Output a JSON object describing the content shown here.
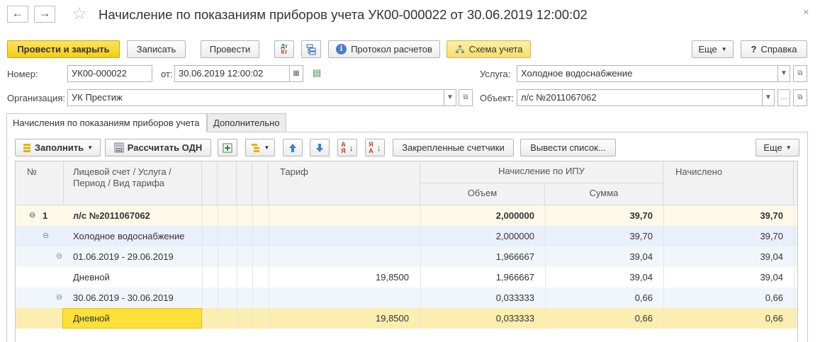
{
  "window": {
    "title": "Начисление по показаниям приборов учета УК00-000022 от 30.06.2019 12:00:02",
    "back_glyph": "←",
    "forward_glyph": "→",
    "close_glyph": "×"
  },
  "command_bar": {
    "post_and_close": "Провести и закрыть",
    "save": "Записать",
    "post": "Провести",
    "calc_protocol": "Протокол расчетов",
    "accounting_scheme": "Схема учета",
    "more": "Еще",
    "help": "Справка",
    "dt_kt_icon": "Дт/Кт"
  },
  "header": {
    "number_label": "Номер:",
    "number_value": "УК00-000022",
    "date_label": "от:",
    "date_value": "30.06.2019 12:00:02",
    "service_label": "Услуга:",
    "service_value": "Холодное водоснабжение",
    "org_label": "Организация:",
    "org_value": "УК Престиж",
    "object_label": "Объект:",
    "object_value": "л/с №2011067062"
  },
  "tabs": [
    {
      "label": "Начисления по показаниям приборов учета",
      "active": true
    },
    {
      "label": "Дополнительно",
      "active": false
    }
  ],
  "table_toolbar": {
    "fill": "Заполнить",
    "calc_odn": "Рассчитать ОДН",
    "fixed_meters": "Закрепленные счетчики",
    "output_list": "Вывести список...",
    "more": "Еще"
  },
  "table": {
    "headers": {
      "num": "№",
      "account_line1": "Лицевой счет / Услуга /",
      "account_line2": "Период / Вид тарифа",
      "tariff": "Тариф",
      "ipu_group": "Начисление по ИПУ",
      "volume": "Объем",
      "sum": "Сумма",
      "accrued": "Начислено"
    },
    "rows": [
      {
        "num": "1",
        "tree": "⊖",
        "name": "л/с №2011067062",
        "tariff": "",
        "volume": "2,000000",
        "sum": "39,70",
        "accrued": "39,70"
      },
      {
        "num": "",
        "tree": "⊖",
        "name": "Холодное водоснабжение",
        "tariff": "",
        "volume": "2,000000",
        "sum": "39,70",
        "accrued": "39,70"
      },
      {
        "num": "",
        "tree": "⊖",
        "name": "01.06.2019 - 29.06.2019",
        "tariff": "",
        "volume": "1,966667",
        "sum": "39,04",
        "accrued": "39,04"
      },
      {
        "num": "",
        "tree": "",
        "name": "Дневной",
        "tariff": "19,8500",
        "volume": "1,966667",
        "sum": "39,04",
        "accrued": "39,04"
      },
      {
        "num": "",
        "tree": "⊖",
        "name": "30.06.2019 - 30.06.2019",
        "tariff": "",
        "volume": "0,033333",
        "sum": "0,66",
        "accrued": "0,66"
      },
      {
        "num": "",
        "tree": "",
        "name": "Дневной",
        "tariff": "19,8500",
        "volume": "0,033333",
        "sum": "0,66",
        "accrued": "0,66"
      }
    ]
  },
  "colors": {
    "primary_button": "#f3cc16",
    "row_level1": "#fdf9e8",
    "row_level2": "#e7f0fb",
    "row_level3": "#f1f6fc",
    "row_selected": "#fbeeb0",
    "cell_selected": "#fde03a"
  }
}
